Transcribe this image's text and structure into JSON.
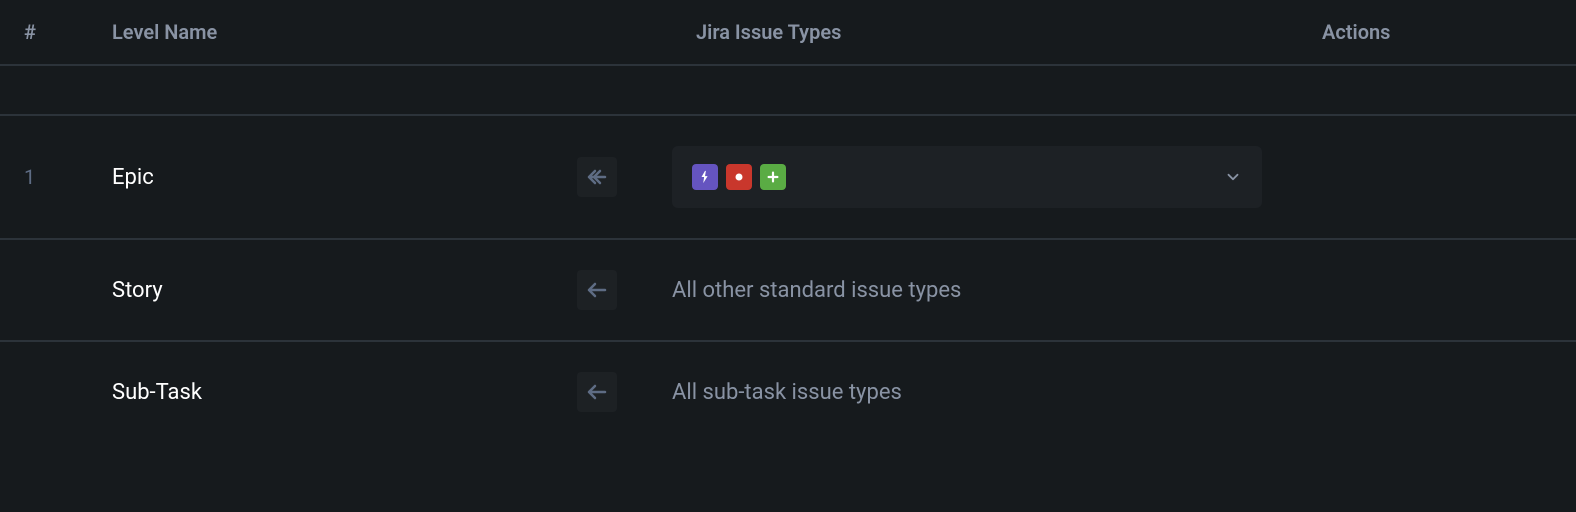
{
  "headers": {
    "num": "#",
    "level_name": "Level Name",
    "issue_types": "Jira Issue Types",
    "actions": "Actions"
  },
  "rows": [
    {
      "num": "1",
      "name": "Epic",
      "types_text": "",
      "has_dropdown": true
    },
    {
      "num": "",
      "name": "Story",
      "types_text": "All other standard issue types",
      "has_dropdown": false
    },
    {
      "num": "",
      "name": "Sub-Task",
      "types_text": "All sub-task issue types",
      "has_dropdown": false
    }
  ]
}
